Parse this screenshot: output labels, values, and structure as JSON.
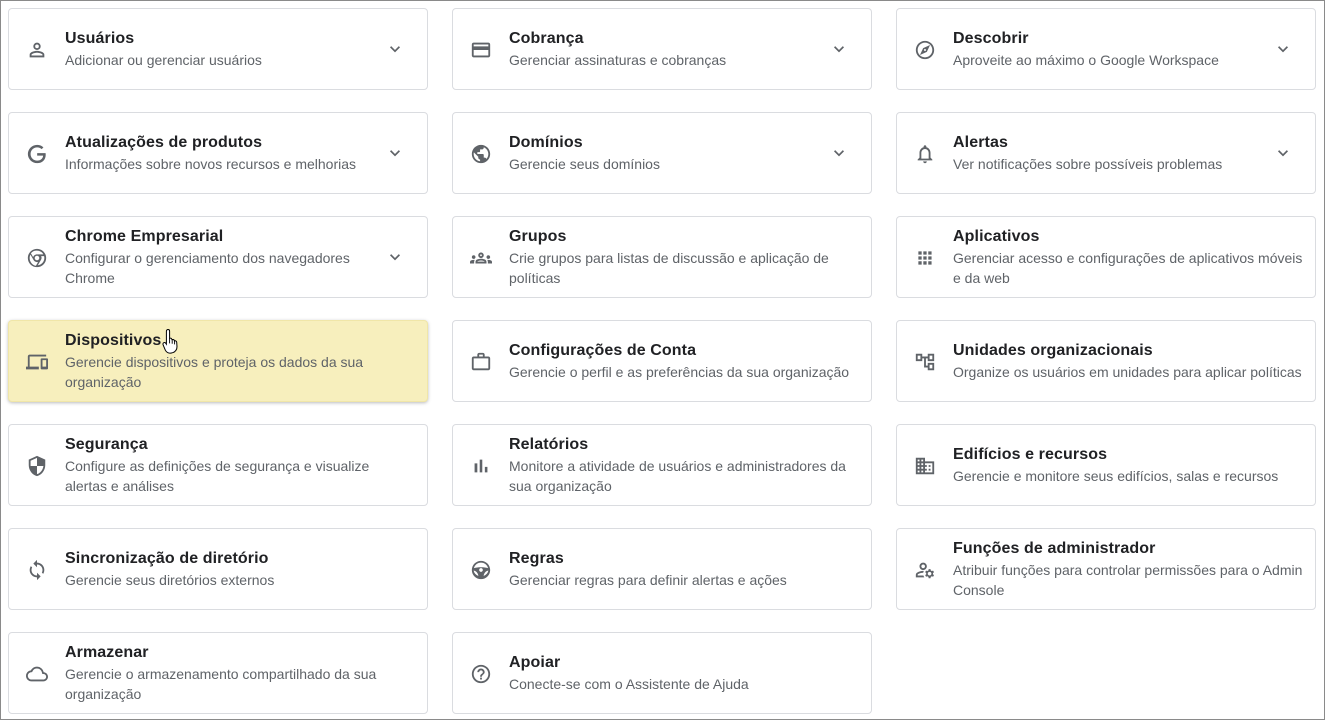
{
  "cards": {
    "usuarios": {
      "title": "Usuários",
      "desc": "Adicionar ou gerenciar usuários",
      "icon": "person-icon",
      "expandable": true
    },
    "cobranca": {
      "title": "Cobrança",
      "desc": "Gerenciar assinaturas e cobranças",
      "icon": "credit-card-icon",
      "expandable": true
    },
    "descobrir": {
      "title": "Descobrir",
      "desc": "Aproveite ao máximo o Google Workspace",
      "icon": "compass-icon",
      "expandable": true
    },
    "atualizacoes": {
      "title": "Atualizações de produtos",
      "desc": "Informações sobre novos recursos e melhorias",
      "icon": "google-g-icon",
      "expandable": true
    },
    "dominios": {
      "title": "Domínios",
      "desc": "Gerencie seus domínios",
      "icon": "globe-icon",
      "expandable": true
    },
    "alertas": {
      "title": "Alertas",
      "desc": "Ver notificações sobre possíveis problemas",
      "icon": "bell-icon",
      "expandable": true
    },
    "chrome": {
      "title": "Chrome Empresarial",
      "desc": "Configurar o gerenciamento dos navegadores Chrome",
      "icon": "chrome-icon",
      "expandable": true
    },
    "grupos": {
      "title": "Grupos",
      "desc": "Crie grupos para listas de discussão e aplicação de políticas",
      "icon": "groups-icon",
      "expandable": false
    },
    "aplicativos": {
      "title": "Aplicativos",
      "desc": "Gerenciar acesso e configurações de aplicativos móveis e da web",
      "icon": "apps-grid-icon",
      "expandable": false
    },
    "dispositivos": {
      "title": "Dispositivos",
      "desc": "Gerencie dispositivos e proteja os dados da sua organização",
      "icon": "devices-icon",
      "expandable": false
    },
    "conta": {
      "title": "Configurações de Conta",
      "desc": "Gerencie o perfil e as preferências da sua organização",
      "icon": "briefcase-icon",
      "expandable": false
    },
    "unidades": {
      "title": "Unidades organizacionais",
      "desc": "Organize os usuários em unidades para aplicar políticas",
      "icon": "org-tree-icon",
      "expandable": false
    },
    "seguranca": {
      "title": "Segurança",
      "desc": "Configure as definições de segurança e visualize alertas e análises",
      "icon": "shield-icon",
      "expandable": false
    },
    "relatorios": {
      "title": "Relatórios",
      "desc": "Monitore a atividade de usuários e administradores da sua organização",
      "icon": "bar-chart-icon",
      "expandable": false
    },
    "edificios": {
      "title": "Edifícios e recursos",
      "desc": "Gerencie e monitore seus edifícios, salas e recursos",
      "icon": "building-icon",
      "expandable": false
    },
    "sincronizacao": {
      "title": "Sincronização de diretório",
      "desc": "Gerencie seus diretórios externos",
      "icon": "sync-icon",
      "expandable": false
    },
    "regras": {
      "title": "Regras",
      "desc": "Gerenciar regras para definir alertas e ações",
      "icon": "steering-wheel-icon",
      "expandable": false
    },
    "funcoes": {
      "title": "Funções de administrador",
      "desc": "Atribuir funções para controlar permissões para o Admin Console",
      "icon": "admin-gear-icon",
      "expandable": false
    },
    "armazenar": {
      "title": "Armazenar",
      "desc": "Gerencie o armazenamento compartilhado da sua organização",
      "icon": "cloud-icon",
      "expandable": false
    },
    "apoiar": {
      "title": "Apoiar",
      "desc": "Conecte-se com o Assistente de Ajuda",
      "icon": "help-icon",
      "expandable": false
    }
  },
  "colors": {
    "highlight": "#f7efbd",
    "title": "#202124",
    "desc": "#5f6368",
    "border": "#dadce0"
  }
}
